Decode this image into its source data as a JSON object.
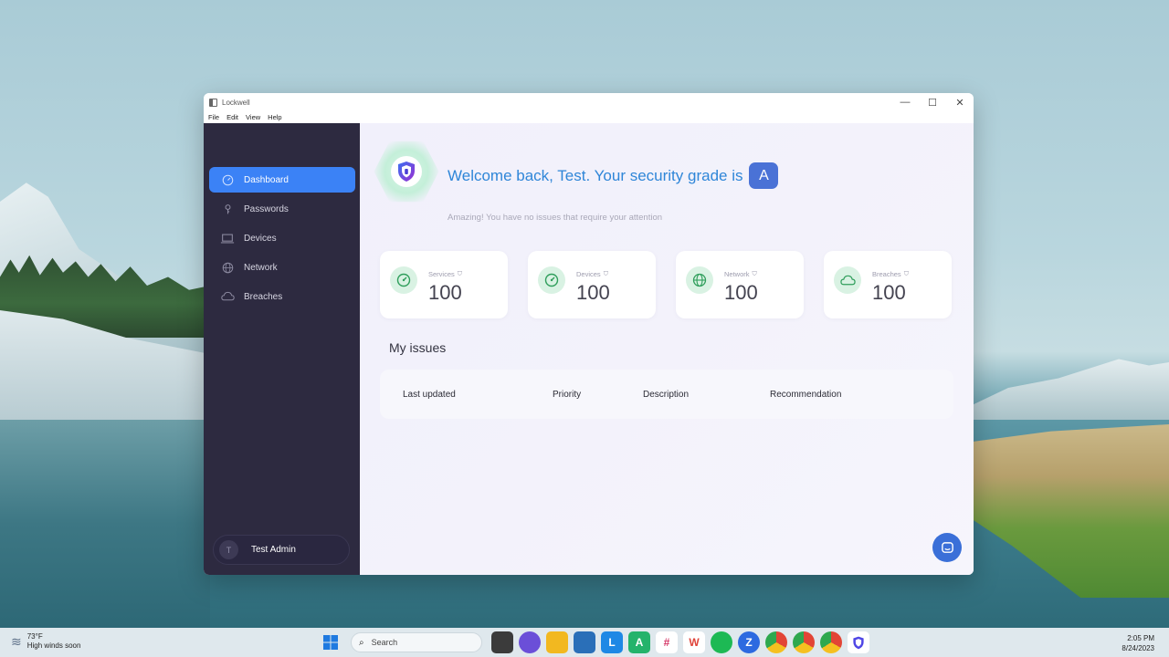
{
  "window": {
    "title": "Lockwell",
    "controls": {
      "minimize": "—",
      "maximize": "☐",
      "close": "✕"
    },
    "menu": [
      "File",
      "Edit",
      "View",
      "Help"
    ]
  },
  "sidebar": {
    "items": [
      {
        "label": "Dashboard",
        "icon": "dashboard-icon",
        "active": true
      },
      {
        "label": "Passwords",
        "icon": "key-icon",
        "active": false
      },
      {
        "label": "Devices",
        "icon": "laptop-icon",
        "active": false
      },
      {
        "label": "Network",
        "icon": "globe-icon",
        "active": false
      },
      {
        "label": "Breaches",
        "icon": "cloud-icon",
        "active": false
      }
    ],
    "user": {
      "initial": "T",
      "name": "Test Admin"
    }
  },
  "main": {
    "headline": "Welcome back, Test. Your security grade is",
    "grade": "A",
    "subline": "Amazing! You have no issues that require your attention",
    "cards": [
      {
        "label": "Services",
        "value": "100",
        "icon": "gauge-icon"
      },
      {
        "label": "Devices",
        "value": "100",
        "icon": "gauge-icon"
      },
      {
        "label": "Network",
        "value": "100",
        "icon": "globe-icon"
      },
      {
        "label": "Breaches",
        "value": "100",
        "icon": "cloud-icon"
      }
    ],
    "issues_title": "My issues",
    "issues_columns": [
      "Last updated",
      "Priority",
      "Description",
      "Recommendation"
    ]
  },
  "taskbar": {
    "weather": {
      "temp": "73°F",
      "desc": "High winds soon"
    },
    "search_placeholder": "Search",
    "time": "2:05 PM",
    "date": "8/24/2023"
  },
  "colors": {
    "sidebar_bg": "#2d2a40",
    "accent": "#3b82f6",
    "headline": "#2f86d8",
    "grade_badge": "#4a72d6",
    "card_icon_bg": "#d9f2e3",
    "success_green": "#2f9e5b"
  }
}
